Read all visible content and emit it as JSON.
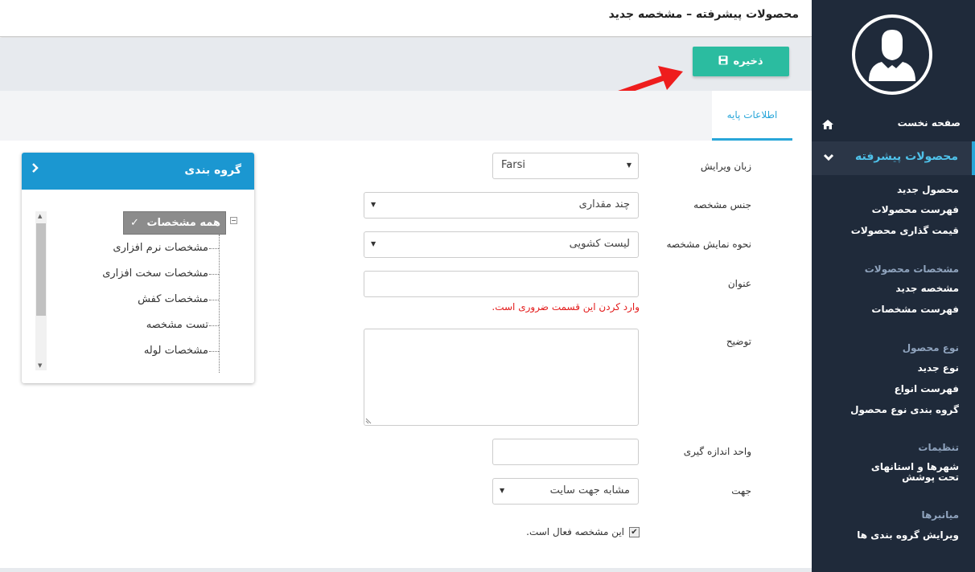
{
  "header": {
    "title": "محصولات پیشرفته – مشخصه جدید"
  },
  "toolbar": {
    "save_label": "ذخیره"
  },
  "tabs": [
    {
      "label": "اطلاعات پایه"
    }
  ],
  "form": {
    "edit_language": {
      "label": "زبان ویرایش",
      "value": "Farsi"
    },
    "feature_type": {
      "label": "جنس مشخصه",
      "value": "چند مقداری"
    },
    "display_mode": {
      "label": "نحوه نمایش مشخصه",
      "value": "لیست کشویی"
    },
    "title": {
      "label": "عنوان",
      "value": "",
      "error": "وارد کردن این قسمت ضروری است."
    },
    "description": {
      "label": "توضیح",
      "value": ""
    },
    "unit": {
      "label": "واحد اندازه گیری",
      "value": ""
    },
    "direction": {
      "label": "جهت",
      "value": "مشابه جهت سایت"
    },
    "active": {
      "label": "این مشخصه فعال است.",
      "checked": true
    }
  },
  "group_panel": {
    "title": "گروه بندی",
    "root": "همه مشخصات",
    "children": [
      "مشخصات نرم افزاری",
      "مشخصات سخت افزاری",
      "مشخصات کفش",
      "تست مشخصه",
      "مشخصات لوله"
    ]
  },
  "sidebar": {
    "home": "صفحه نخست",
    "active_section": "محصولات پیشرفته",
    "products": [
      "محصول جدید",
      "فهرست محصولات",
      "قیمت گذاری محصولات"
    ],
    "features_heading": "مشخصات محصولات",
    "features": [
      "مشخصه جدید",
      "فهرست مشخصات"
    ],
    "types_heading": "نوع محصول",
    "types": [
      "نوع جدید",
      "فهرست انواع",
      "گروه بندی نوع محصول"
    ],
    "settings_heading": "تنظیمات",
    "settings": [
      "شهرها و استانهای تحت پوشش"
    ],
    "shortcuts_heading": "میانبرها",
    "shortcuts": [
      "ویرایش گروه بندی ها"
    ]
  },
  "colors": {
    "accent": "#29a6d9",
    "save": "#2bbca0",
    "sidebar": "#1f2a3a",
    "error": "#e31b1b"
  }
}
